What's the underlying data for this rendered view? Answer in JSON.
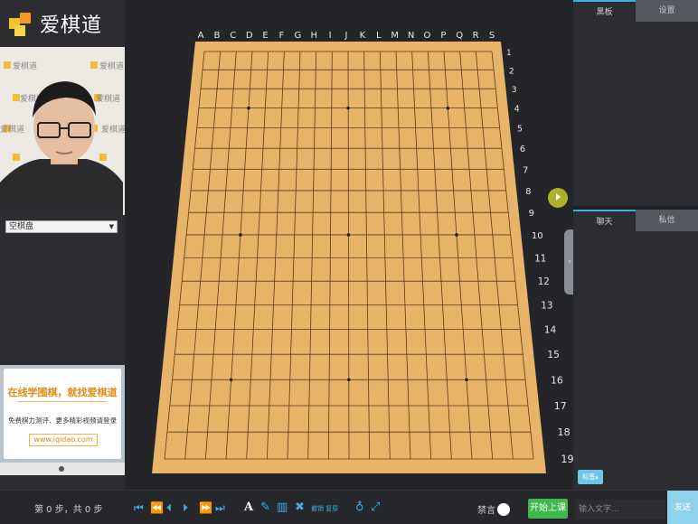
{
  "brand": {
    "logo_text": "爱棋道"
  },
  "video": {
    "watermark_text": "爱棋道"
  },
  "sidebar": {
    "board_select": "空棋盘"
  },
  "ad": {
    "headline": "在线学围棋，就找爱棋道",
    "subtext": "免费棋力测评、更多精彩视频请登录",
    "url": "www.iqidao.com"
  },
  "board": {
    "columns": [
      "A",
      "B",
      "C",
      "D",
      "E",
      "F",
      "G",
      "H",
      "I",
      "J",
      "K",
      "L",
      "M",
      "N",
      "O",
      "P",
      "Q",
      "R",
      "S"
    ],
    "rows": [
      "1",
      "2",
      "3",
      "4",
      "5",
      "6",
      "7",
      "8",
      "9",
      "10",
      "11",
      "12",
      "13",
      "14",
      "15",
      "16",
      "17",
      "18",
      "19"
    ],
    "wood_color": "#e7b46a",
    "line_color": "#5a3a18"
  },
  "right_panel": {
    "top_tabs": [
      {
        "label": "黑板",
        "active": true
      },
      {
        "label": "设置",
        "active": false
      }
    ],
    "chat_tabs": [
      {
        "label": "聊天",
        "active": true
      },
      {
        "label": "私信",
        "active": false
      }
    ],
    "tag_button": "标签▴"
  },
  "toolbar": {
    "step_text": "第 0 步，共 0 步",
    "nav_icons": [
      "first-icon",
      "prev-fast-icon",
      "prev-icon",
      "next-icon",
      "next-fast-icon",
      "last-icon"
    ],
    "text_tool": "A",
    "back_label": "撤销 复原",
    "mute_label": "禁言",
    "start_label": "开始上课",
    "chat_placeholder": "输入文字...",
    "send_label": "发送"
  },
  "colors": {
    "accent": "#3ab2e0",
    "start_green": "#3fb84e",
    "ad_orange": "#e28a12"
  }
}
